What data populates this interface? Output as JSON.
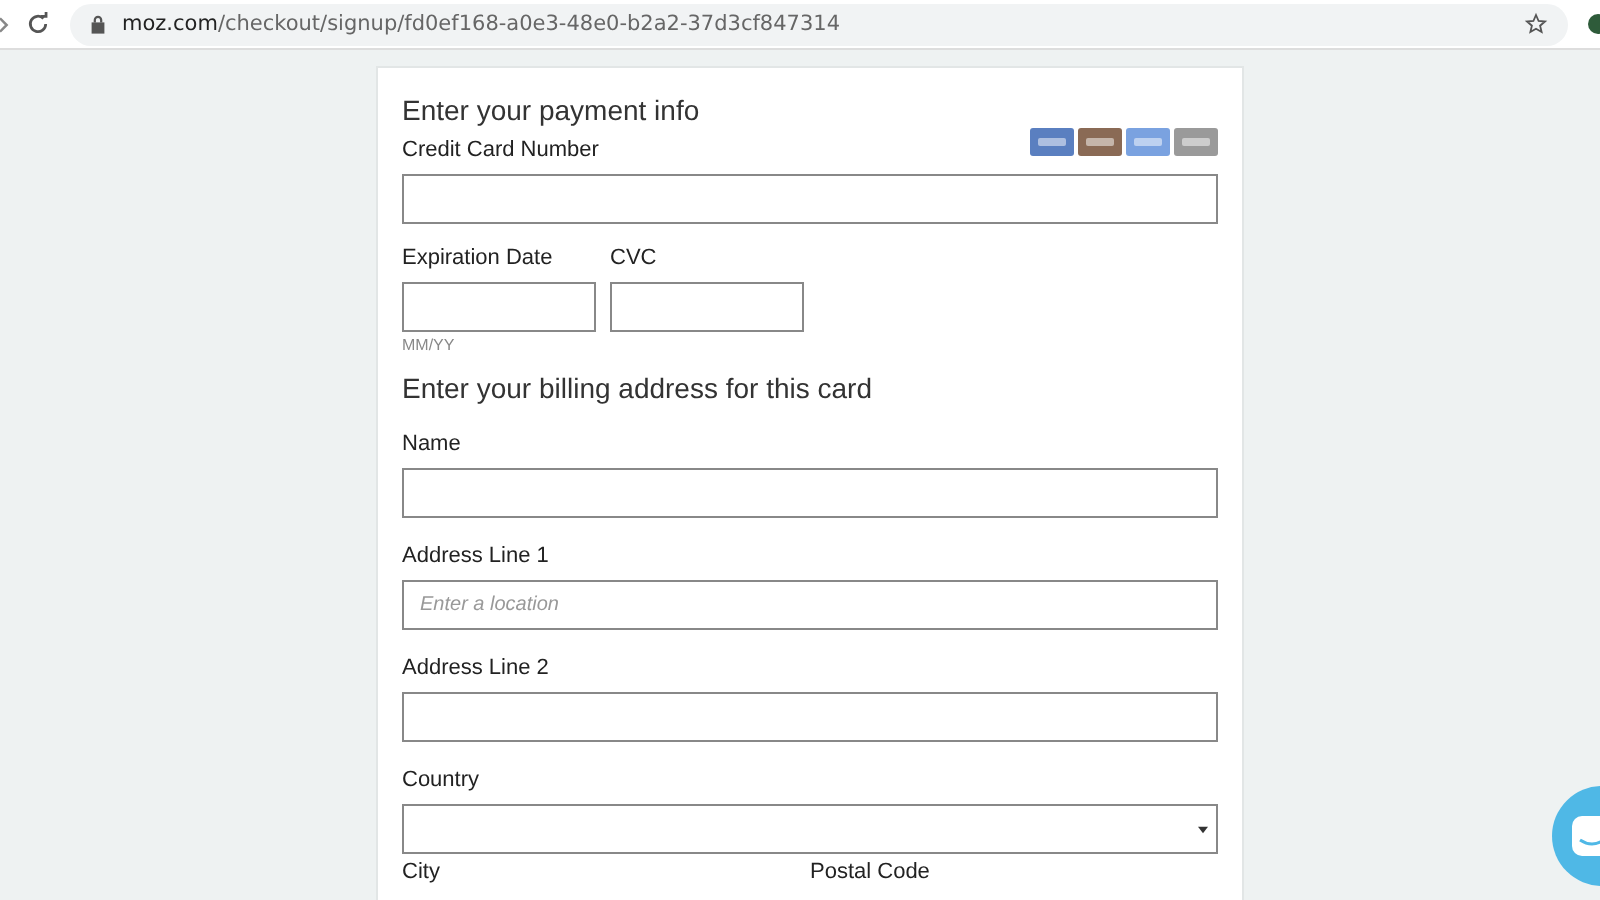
{
  "browser": {
    "url_host": "moz.com",
    "url_path": "/checkout/signup/fd0ef168-a0e3-48e0-b2a2-37d3cf847314"
  },
  "payment": {
    "title": "Enter your payment info",
    "card_label": "Credit Card Number",
    "expiration_label": "Expiration Date",
    "expiration_hint": "MM/YY",
    "cvc_label": "CVC"
  },
  "billing": {
    "title": "Enter your billing address for this card",
    "fields": [
      {
        "label": "Name",
        "kind": "text"
      },
      {
        "label": "Address Line 1",
        "kind": "text",
        "placeholder": "Enter a location"
      },
      {
        "label": "Address Line 2",
        "kind": "text"
      },
      {
        "label": "Country",
        "kind": "select"
      }
    ],
    "bottom_labels": [
      "City",
      "Postal Code"
    ]
  }
}
